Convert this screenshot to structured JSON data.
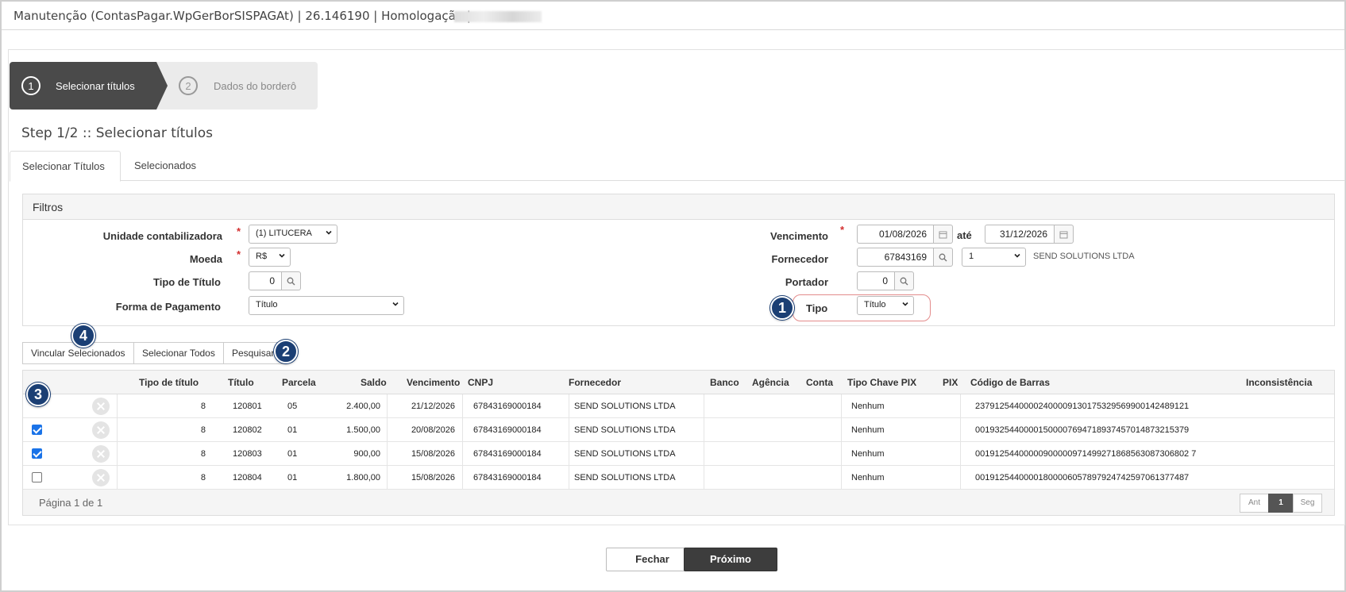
{
  "window": {
    "title": "Manutenção (ContasPagar.WpGerBorSISPAGAt) | 26.146190 | Homologação |"
  },
  "wizard": {
    "steps": [
      {
        "num": "1",
        "label": "Selecionar títulos"
      },
      {
        "num": "2",
        "label": "Dados do borderô"
      }
    ]
  },
  "step_title": "Step 1/2 :: Selecionar títulos",
  "tabs": [
    {
      "label": "Selecionar Títulos"
    },
    {
      "label": "Selecionados"
    }
  ],
  "filters": {
    "title": "Filtros",
    "required_mark": "*",
    "unidade": {
      "label": "Unidade contabilizadora",
      "value": "(1) LITUCERA"
    },
    "moeda": {
      "label": "Moeda",
      "value": "R$"
    },
    "tipo_titulo": {
      "label": "Tipo de Título",
      "value": "0"
    },
    "forma_pagamento": {
      "label": "Forma de Pagamento",
      "value": "Título"
    },
    "vencimento": {
      "label": "Vencimento",
      "from": "01/08/2026",
      "ate_label": "até",
      "to": "31/12/2026"
    },
    "fornecedor": {
      "label": "Fornecedor",
      "code": "67843169",
      "branch": "1",
      "name": "SEND SOLUTIONS LTDA"
    },
    "portador": {
      "label": "Portador",
      "value": "0"
    },
    "tipo": {
      "label": "Tipo",
      "value": "Título"
    }
  },
  "markers": [
    "1",
    "2",
    "3",
    "4"
  ],
  "actions": {
    "vincular": "Vincular Selecionados",
    "selecionar_todos": "Selecionar Todos",
    "pesquisar": "Pesquisar"
  },
  "table": {
    "headers": [
      "Tipo de título",
      "Título",
      "Parcela",
      "Saldo",
      "Vencimento",
      "CNPJ",
      "Fornecedor",
      "Banco",
      "Agência",
      "Conta",
      "Tipo Chave PIX",
      "PIX",
      "Código de Barras",
      "Inconsistência"
    ],
    "rows": [
      {
        "checkbox": "none",
        "tipo": "8",
        "titulo": "120801",
        "parcela": "05",
        "saldo": "2.400,00",
        "vencimento": "21/12/2026",
        "cnpj": "67843169000184",
        "fornecedor": "SEND SOLUTIONS LTDA",
        "chave_pix": "Nenhum",
        "codigo": "23791254400002400009130175329569900142489121"
      },
      {
        "checkbox": "checked",
        "tipo": "8",
        "titulo": "120802",
        "parcela": "01",
        "saldo": "1.500,00",
        "vencimento": "20/08/2026",
        "cnpj": "67843169000184",
        "fornecedor": "SEND SOLUTIONS LTDA",
        "chave_pix": "Nenhum",
        "codigo": "00193254400001500007694718937457014873215379"
      },
      {
        "checkbox": "checked",
        "tipo": "8",
        "titulo": "120803",
        "parcela": "01",
        "saldo": "900,00",
        "vencimento": "15/08/2026",
        "cnpj": "67843169000184",
        "fornecedor": "SEND SOLUTIONS LTDA",
        "chave_pix": "Nenhum",
        "codigo": "00191254400000900000971499271868563087306802 7"
      },
      {
        "checkbox": "unchecked",
        "tipo": "8",
        "titulo": "120804",
        "parcela": "01",
        "saldo": "1.800,00",
        "vencimento": "15/08/2026",
        "cnpj": "67843169000184",
        "fornecedor": "SEND SOLUTIONS LTDA",
        "chave_pix": "Nenhum",
        "codigo": "00191254400001800006057897924742597061377487"
      }
    ]
  },
  "pager": {
    "info": "Página 1 de 1",
    "prev": "Ant",
    "current": "1",
    "next": "Seg"
  },
  "footer": {
    "fechar": "Fechar",
    "proximo": "Próximo"
  },
  "colors": {
    "dark": "#4a4a4a",
    "marker": "#1b3f74",
    "highlight": "#e38b8b",
    "required": "#d32f2f",
    "checkbox": "#1a73e8"
  }
}
